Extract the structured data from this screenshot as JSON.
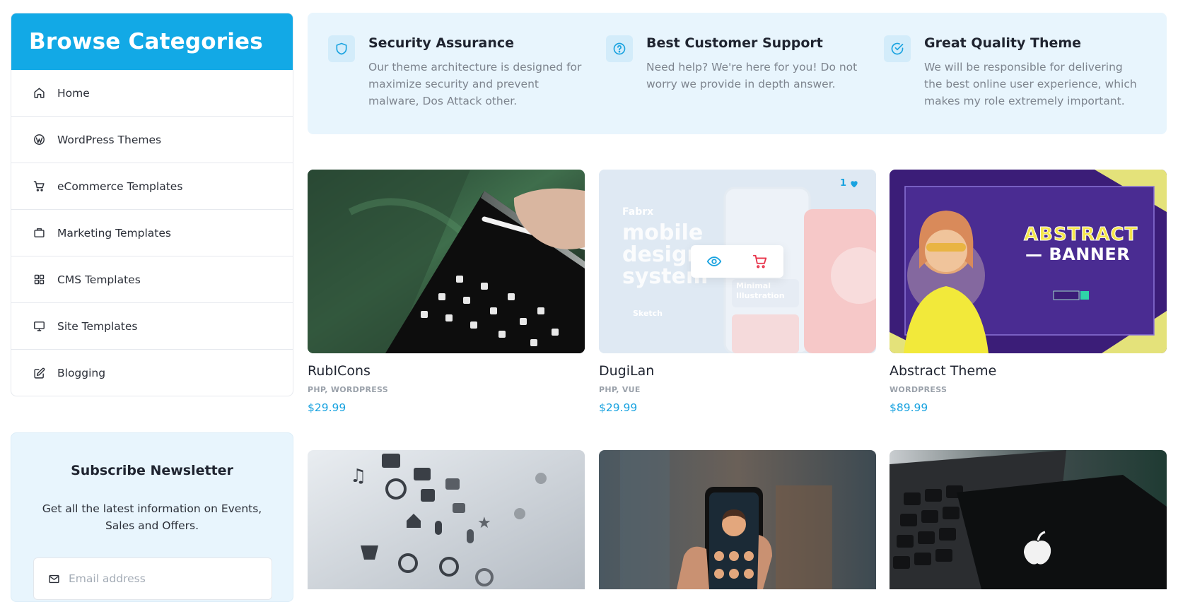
{
  "sidebar": {
    "title": "Browse Categories",
    "items": [
      {
        "label": "Home",
        "icon": "home-icon"
      },
      {
        "label": "WordPress Themes",
        "icon": "wordpress-icon"
      },
      {
        "label": "eCommerce Templates",
        "icon": "cart-icon"
      },
      {
        "label": "Marketing Templates",
        "icon": "briefcase-icon"
      },
      {
        "label": "CMS Templates",
        "icon": "grid-icon"
      },
      {
        "label": "Site Templates",
        "icon": "monitor-icon"
      },
      {
        "label": "Blogging",
        "icon": "edit-icon"
      }
    ]
  },
  "newsletter": {
    "title": "Subscribe Newsletter",
    "text": "Get all the latest information on Events, Sales and Offers.",
    "email_placeholder": "Email address",
    "email_value": ""
  },
  "features": [
    {
      "title": "Security Assurance",
      "text": "Our theme architecture is designed for maximize security and prevent malware, Dos Attack other.",
      "icon": "shield-icon"
    },
    {
      "title": "Best Customer Support",
      "text": "Need help? We're here for you! Do not worry we provide in depth answer.",
      "icon": "help-circle-icon"
    },
    {
      "title": "Great Quality Theme",
      "text": "We will be responsible for delivering the best online user experience, which makes my role extremely important.",
      "icon": "check-circle-icon"
    }
  ],
  "products": [
    {
      "name": "RubICons",
      "tags": "PHP, WORDPRESS",
      "price": "$29.99"
    },
    {
      "name": "DugiLan",
      "tags": "PHP, VUE",
      "price": "$29.99",
      "likes": "1",
      "preview": {
        "brand": "Fabrx",
        "headline": [
          "mobile",
          "design",
          "system"
        ],
        "card": [
          "Minimal",
          "Illustration"
        ],
        "footer": "Sketch"
      }
    },
    {
      "name": "Abstract Theme",
      "tags": "WORDPRESS",
      "price": "$89.99",
      "preview": {
        "headline": "ABSTRACT",
        "subline": "— BANNER"
      }
    },
    {
      "name": "",
      "tags": "",
      "price": ""
    },
    {
      "name": "",
      "tags": "",
      "price": ""
    },
    {
      "name": "",
      "tags": "",
      "price": ""
    }
  ],
  "colors": {
    "accent": "#12a9e6",
    "price": "#1aa3e0",
    "soft_bg": "#e8f5fd"
  }
}
